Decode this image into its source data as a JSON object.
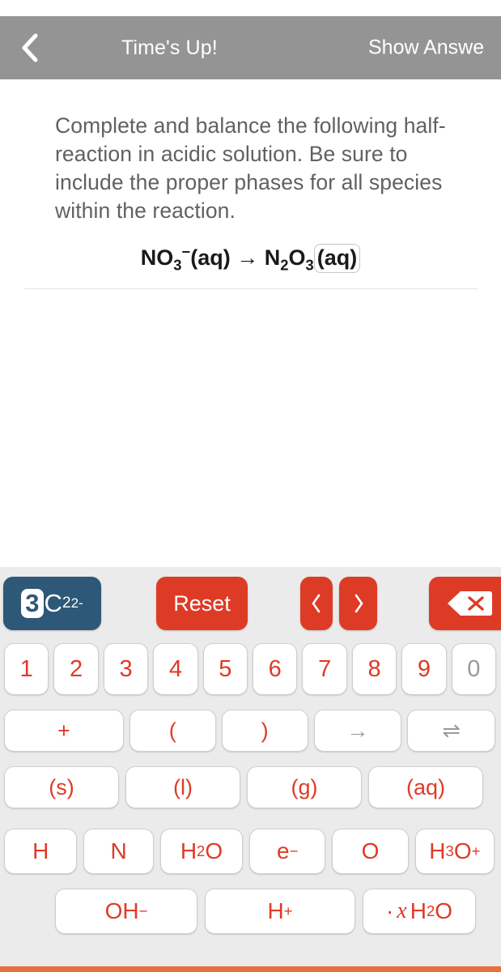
{
  "header": {
    "back_icon": "chevron-left-icon",
    "title": "Time's Up!",
    "show_answer_label": "Show Answe",
    "background_color": "#949494"
  },
  "question": {
    "prompt": "Complete and balance the following half-reaction in acidic solution. Be sure to include the proper phases for all species within the reaction.",
    "equation": {
      "reactant": {
        "formula": "NO",
        "sub": "3",
        "charge": "−",
        "phase": "(aq)"
      },
      "arrow": "→",
      "product": {
        "formula_n": "N",
        "sub_n": "2",
        "formula_o": "O",
        "sub_o": "3",
        "phase": "(aq)",
        "phase_boxed": true
      }
    }
  },
  "keypad": {
    "background_color": "#ebebeb",
    "accent_color": "#de3b26",
    "mode_color": "#2e5878",
    "mode_badge": {
      "coefficient": "3",
      "element": "C",
      "subscript": "2",
      "charge": "2-"
    },
    "reset_label": "Reset",
    "nav_prev_icon": "chevron-left-icon",
    "nav_next_icon": "chevron-right-icon",
    "backspace_icon": "backspace-icon",
    "digits": [
      {
        "label": "1",
        "enabled": true
      },
      {
        "label": "2",
        "enabled": true
      },
      {
        "label": "3",
        "enabled": true
      },
      {
        "label": "4",
        "enabled": true
      },
      {
        "label": "5",
        "enabled": true
      },
      {
        "label": "6",
        "enabled": true
      },
      {
        "label": "7",
        "enabled": true
      },
      {
        "label": "8",
        "enabled": true
      },
      {
        "label": "9",
        "enabled": true
      },
      {
        "label": "0",
        "enabled": false
      }
    ],
    "operators": [
      {
        "label": "+",
        "enabled": true
      },
      {
        "label": "(",
        "enabled": true
      },
      {
        "label": ")",
        "enabled": true
      },
      {
        "label": "→",
        "enabled": false
      },
      {
        "label": "⇌",
        "enabled": false
      }
    ],
    "phases": [
      {
        "label": "(s)"
      },
      {
        "label": "(l)"
      },
      {
        "label": "(g)"
      },
      {
        "label": "(aq)"
      }
    ],
    "species": {
      "h": "H",
      "n": "N",
      "water": {
        "h": "H",
        "sub": "2",
        "o": "O"
      },
      "electron": {
        "e": "e",
        "charge": "−"
      },
      "o": "O",
      "hydronium": {
        "h": "H",
        "sub": "3",
        "o": "O",
        "charge": "+"
      }
    },
    "ions": {
      "hydroxide": {
        "oh": "OH",
        "charge": "−"
      },
      "proton": {
        "h": "H",
        "charge": "+"
      },
      "hydrate": {
        "dot": "·",
        "variable": "x",
        "h": "H",
        "sub": "2",
        "o": "O"
      }
    }
  },
  "bottom_bar_color": "#e8703f"
}
